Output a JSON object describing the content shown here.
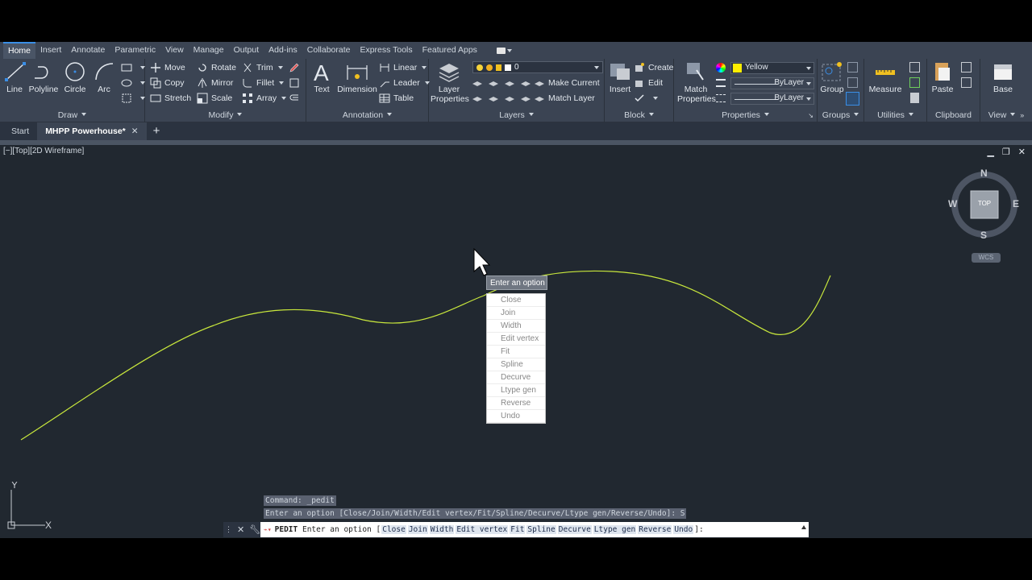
{
  "ribbon_tabs": [
    "Home",
    "Insert",
    "Annotate",
    "Parametric",
    "View",
    "Manage",
    "Output",
    "Add-ins",
    "Collaborate",
    "Express Tools",
    "Featured Apps"
  ],
  "active_tab": "Home",
  "draw": {
    "line": "Line",
    "polyline": "Polyline",
    "circle": "Circle",
    "arc": "Arc",
    "title": "Draw"
  },
  "modify": {
    "move": "Move",
    "rotate": "Rotate",
    "trim": "Trim",
    "copy": "Copy",
    "mirror": "Mirror",
    "fillet": "Fillet",
    "stretch": "Stretch",
    "scale": "Scale",
    "array": "Array",
    "title": "Modify"
  },
  "annotation": {
    "text": "Text",
    "dimension": "Dimension",
    "linear": "Linear",
    "leader": "Leader",
    "table": "Table",
    "title": "Annotation"
  },
  "layers": {
    "layer_properties_1": "Layer",
    "layer_properties_2": "Properties",
    "current_layer": "0",
    "make_current": "Make Current",
    "match_layer": "Match Layer",
    "title": "Layers"
  },
  "block": {
    "insert": "Insert",
    "create": "Create",
    "edit": "Edit",
    "title": "Block"
  },
  "properties": {
    "match_1": "Match",
    "match_2": "Properties",
    "color": "Yellow",
    "linetype": "ByLayer",
    "lineweight": "ByLayer",
    "title": "Properties",
    "color_hex": "#ffee00"
  },
  "groups": {
    "group": "Group",
    "title": "Groups"
  },
  "utilities": {
    "measure": "Measure",
    "title": "Utilities"
  },
  "clipboard": {
    "paste": "Paste",
    "title": "Clipboard"
  },
  "view": {
    "base": "Base",
    "title": "View"
  },
  "doc_tabs": {
    "start": "Start",
    "active": "MHPP Powerhouse*"
  },
  "viewport_label": "[−][Top][2D Wireframe]",
  "viewcube": {
    "n": "N",
    "s": "S",
    "e": "E",
    "w": "W",
    "top": "TOP",
    "wcs": "WCS"
  },
  "ucs": {
    "x": "X",
    "y": "Y"
  },
  "popup": {
    "title": "Enter an option",
    "items": [
      "Close",
      "Join",
      "Width",
      "Edit vertex",
      "Fit",
      "Spline",
      "Decurve",
      "Ltype gen",
      "Reverse",
      "Undo"
    ]
  },
  "command_history": [
    "Command: _pedit",
    "Enter an option [Close/Join/Width/Edit vertex/Fit/Spline/Decurve/Ltype gen/Reverse/Undo]: S"
  ],
  "command_line": {
    "prompt_cmd": "PEDIT",
    "prompt_text": "Enter an option [",
    "options": [
      "Close",
      "Join",
      "Width",
      "Edit vertex",
      "Fit",
      "Spline",
      "Decurve",
      "Ltype gen",
      "Reverse",
      "Undo"
    ],
    "suffix": "]:"
  },
  "colors": {
    "curve": "#c9e83c",
    "background": "#212830",
    "ribbon": "#3b4453",
    "accent": "#3a8ee6"
  }
}
